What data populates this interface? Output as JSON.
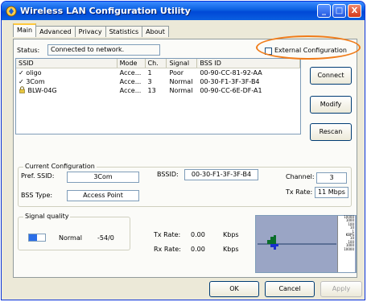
{
  "window": {
    "title": "Wireless LAN Configuration Utility",
    "buttons": [
      "_",
      "□",
      "X"
    ]
  },
  "tabs": [
    "Main",
    "Advanced",
    "Privacy",
    "Statistics",
    "About"
  ],
  "status": {
    "label": "Status:",
    "value": "Connected to network."
  },
  "external_config": {
    "label": "External Configuration",
    "checked": false
  },
  "network_list": {
    "columns": [
      "SSID",
      "Mode",
      "Ch.",
      "Signal",
      "BSS ID"
    ],
    "rows": [
      {
        "mark": "✓",
        "ssid": "oligo",
        "mode": "Acce...",
        "ch": "1",
        "signal": "Poor",
        "bssid": "00-90-CC-81-92-AA"
      },
      {
        "mark": "✓",
        "ssid": "3Com",
        "mode": "Acce...",
        "ch": "3",
        "signal": "Normal",
        "bssid": "00-30-F1-3F-3F-B4"
      },
      {
        "mark": "lock",
        "ssid": "BLW-04G",
        "mode": "Acce...",
        "ch": "13",
        "signal": "Normal",
        "bssid": "00-90-CC-6E-DF-A1"
      }
    ]
  },
  "actions": {
    "connect": "Connect",
    "modify": "Modify",
    "rescan": "Rescan"
  },
  "current_config": {
    "title": "Current Configuration",
    "pref_ssid_label": "Pref. SSID:",
    "pref_ssid_value": "3Com",
    "bss_type_label": "BSS Type:",
    "bss_type_value": "Access Point",
    "bssid_label": "BSSID:",
    "bssid_value": "00-30-F1-3F-3F-B4",
    "channel_label": "Channel:",
    "channel_value": "3",
    "tx_rate_label": "Tx Rate:",
    "tx_rate_value": "11 Mbps"
  },
  "signal_quality": {
    "title": "Signal quality",
    "level": "Normal",
    "value": "-54/0",
    "fill_fraction": 0.5
  },
  "rates": {
    "tx_label": "Tx Rate:",
    "tx_value": "0.00",
    "tx_unit": "Kbps",
    "rx_label": "Rx Rate:",
    "rx_value": "0.00",
    "rx_unit": "Kbps"
  },
  "graph_scale": [
    "10000",
    "1000",
    "100",
    "10",
    "1",
    "KBPS",
    "10",
    "100",
    "1000",
    "10000"
  ],
  "footer": {
    "ok": "OK",
    "cancel": "Cancel",
    "apply": "Apply"
  },
  "colors": {
    "titlebar": "#0a5fe0",
    "highlight": "#f07c1a",
    "signal_bar": "#2b6ee8",
    "graph_bg": "#9aa5c5",
    "graph_trace": "#0a6e2a"
  }
}
